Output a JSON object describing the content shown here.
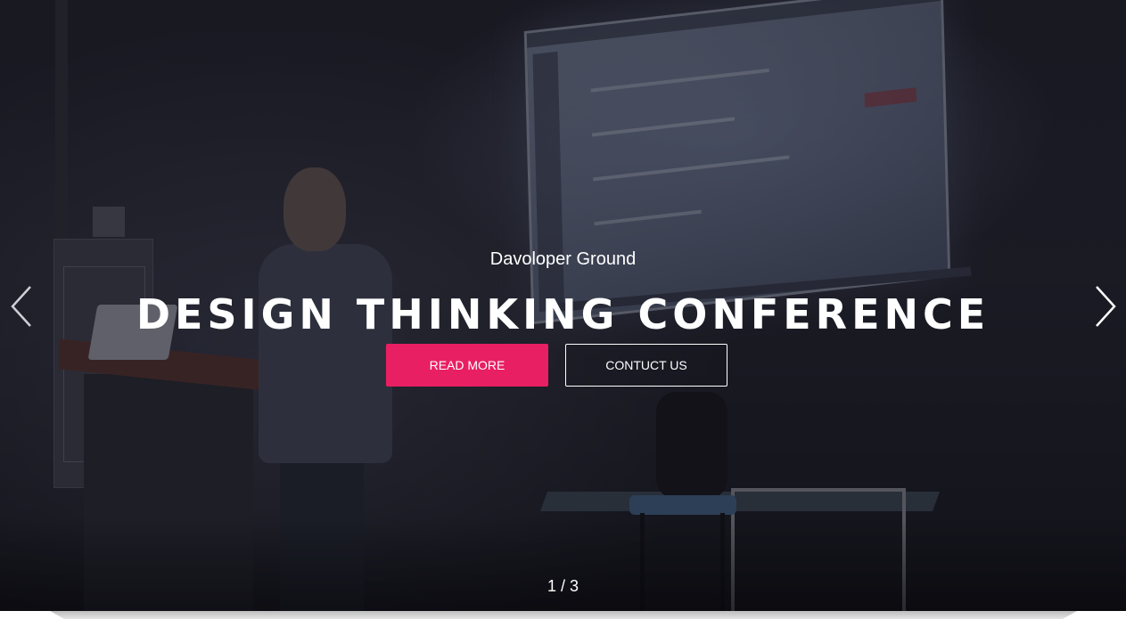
{
  "slider": {
    "subtitle": "Davoloper Ground",
    "title": "DESIGN THINKING CONFERENCE",
    "primary_button": "READ MORE",
    "secondary_button": "CONTUCT US",
    "counter": "1 / 3",
    "prev_icon": "chevron-left-icon",
    "next_icon": "chevron-right-icon"
  },
  "colors": {
    "primary_button_bg": "#e91f63",
    "text": "#ffffff",
    "overlay": "#1f1f29"
  }
}
